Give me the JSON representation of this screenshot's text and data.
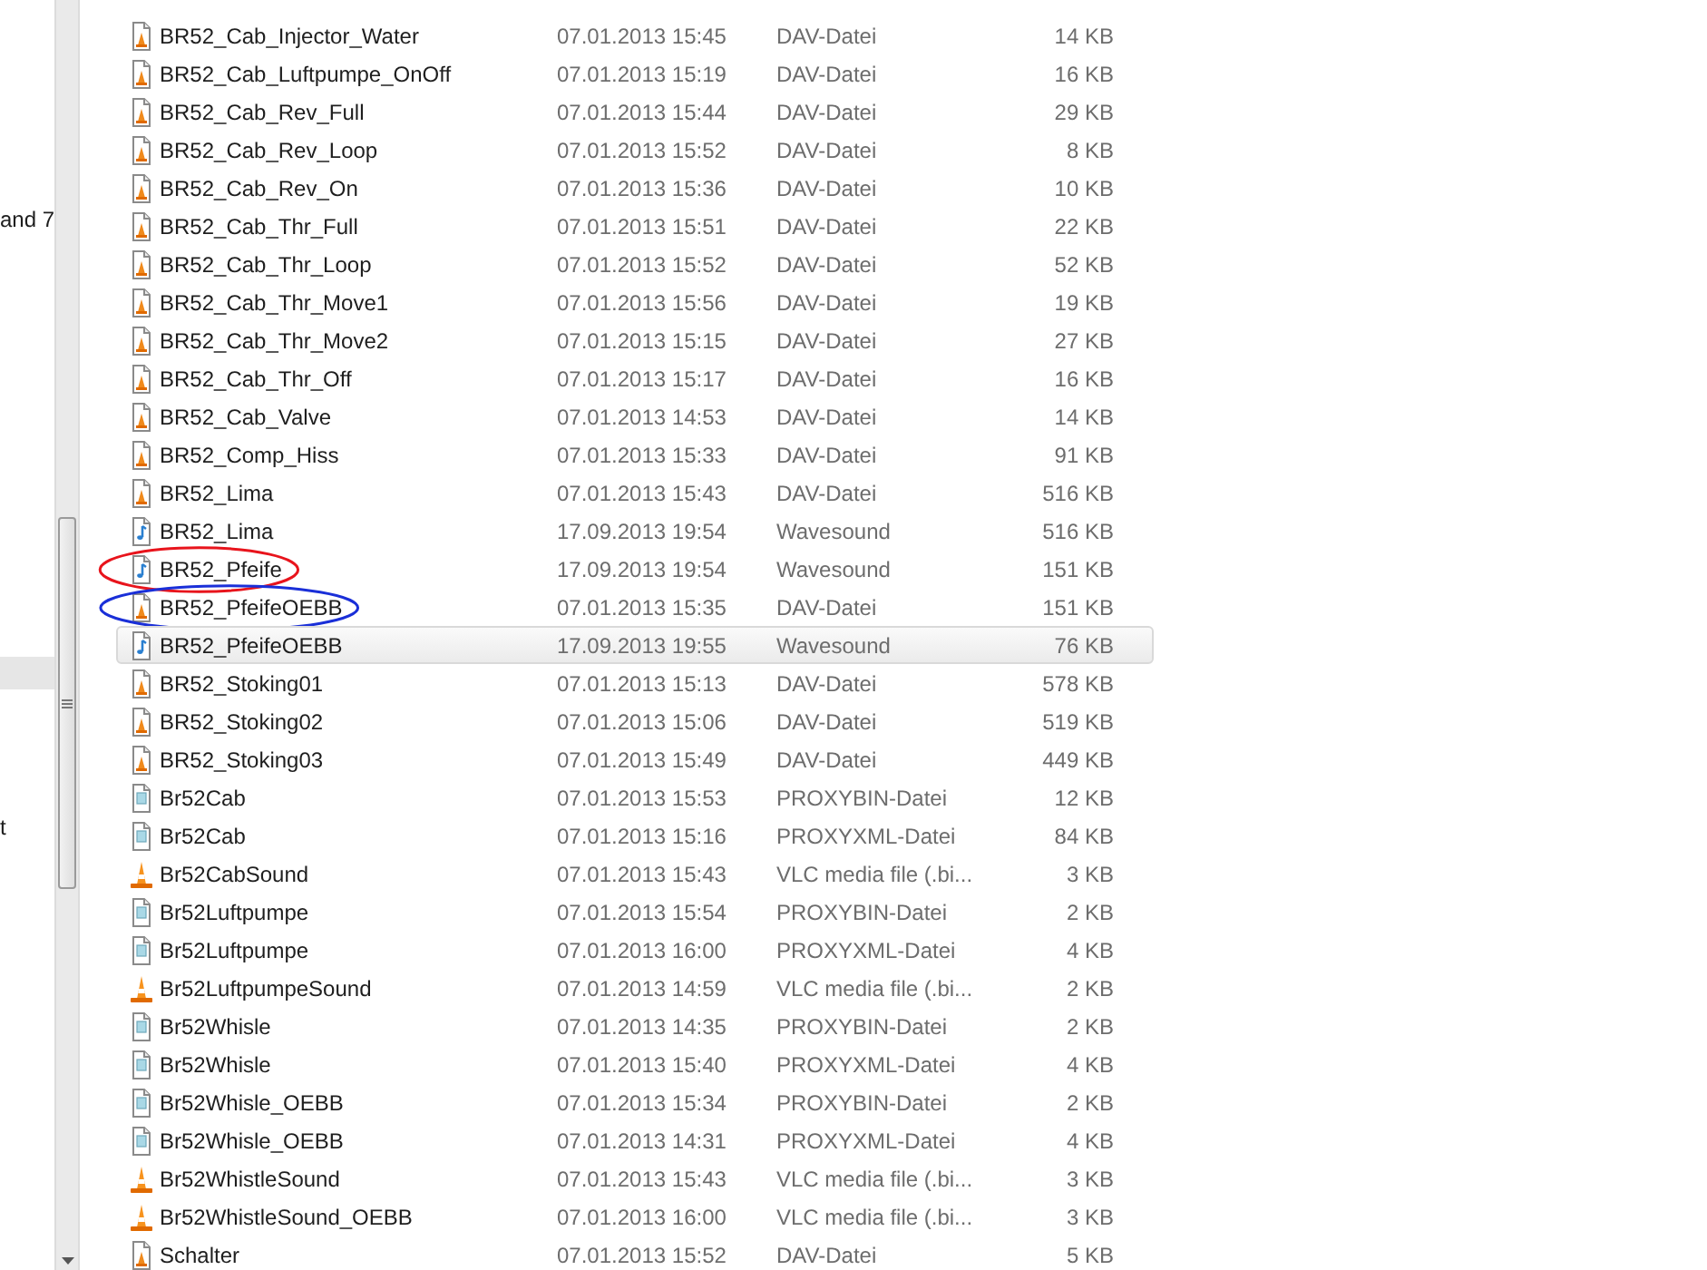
{
  "nav_pane": {
    "items": [
      {
        "label": "and 7",
        "selected": false
      },
      {
        "selected": true
      },
      {
        "label": "t",
        "selected": false
      }
    ]
  },
  "files": [
    {
      "name": "BR52_Cab_Injector_Water",
      "modified": "07.01.2013 15:45",
      "type": "DAV-Datei",
      "size": "14 KB",
      "kind": "dav",
      "selected": false
    },
    {
      "name": "BR52_Cab_Luftpumpe_OnOff",
      "modified": "07.01.2013 15:19",
      "type": "DAV-Datei",
      "size": "16 KB",
      "kind": "dav",
      "selected": false
    },
    {
      "name": "BR52_Cab_Rev_Full",
      "modified": "07.01.2013 15:44",
      "type": "DAV-Datei",
      "size": "29 KB",
      "kind": "dav",
      "selected": false
    },
    {
      "name": "BR52_Cab_Rev_Loop",
      "modified": "07.01.2013 15:52",
      "type": "DAV-Datei",
      "size": "8 KB",
      "kind": "dav",
      "selected": false
    },
    {
      "name": "BR52_Cab_Rev_On",
      "modified": "07.01.2013 15:36",
      "type": "DAV-Datei",
      "size": "10 KB",
      "kind": "dav",
      "selected": false
    },
    {
      "name": "BR52_Cab_Thr_Full",
      "modified": "07.01.2013 15:51",
      "type": "DAV-Datei",
      "size": "22 KB",
      "kind": "dav",
      "selected": false
    },
    {
      "name": "BR52_Cab_Thr_Loop",
      "modified": "07.01.2013 15:52",
      "type": "DAV-Datei",
      "size": "52 KB",
      "kind": "dav",
      "selected": false
    },
    {
      "name": "BR52_Cab_Thr_Move1",
      "modified": "07.01.2013 15:56",
      "type": "DAV-Datei",
      "size": "19 KB",
      "kind": "dav",
      "selected": false
    },
    {
      "name": "BR52_Cab_Thr_Move2",
      "modified": "07.01.2013 15:15",
      "type": "DAV-Datei",
      "size": "27 KB",
      "kind": "dav",
      "selected": false
    },
    {
      "name": "BR52_Cab_Thr_Off",
      "modified": "07.01.2013 15:17",
      "type": "DAV-Datei",
      "size": "16 KB",
      "kind": "dav",
      "selected": false
    },
    {
      "name": "BR52_Cab_Valve",
      "modified": "07.01.2013 14:53",
      "type": "DAV-Datei",
      "size": "14 KB",
      "kind": "dav",
      "selected": false
    },
    {
      "name": "BR52_Comp_Hiss",
      "modified": "07.01.2013 15:33",
      "type": "DAV-Datei",
      "size": "91 KB",
      "kind": "dav",
      "selected": false
    },
    {
      "name": "BR52_Lima",
      "modified": "07.01.2013 15:43",
      "type": "DAV-Datei",
      "size": "516 KB",
      "kind": "dav",
      "selected": false
    },
    {
      "name": "BR52_Lima",
      "modified": "17.09.2013 19:54",
      "type": "Wavesound",
      "size": "516 KB",
      "kind": "wave",
      "selected": false
    },
    {
      "name": "BR52_Pfeife",
      "modified": "17.09.2013 19:54",
      "type": "Wavesound",
      "size": "151 KB",
      "kind": "wave",
      "selected": false,
      "color": "#e8141c"
    },
    {
      "name": "BR52_PfeifeOEBB",
      "modified": "07.01.2013 15:35",
      "type": "DAV-Datei",
      "size": "151 KB",
      "kind": "dav",
      "selected": false,
      "color": "#1a2fd8"
    },
    {
      "name": "BR52_PfeifeOEBB",
      "modified": "17.09.2013 19:55",
      "type": "Wavesound",
      "size": "76 KB",
      "kind": "wave",
      "selected": true
    },
    {
      "name": "BR52_Stoking01",
      "modified": "07.01.2013 15:13",
      "type": "DAV-Datei",
      "size": "578 KB",
      "kind": "dav",
      "selected": false
    },
    {
      "name": "BR52_Stoking02",
      "modified": "07.01.2013 15:06",
      "type": "DAV-Datei",
      "size": "519 KB",
      "kind": "dav",
      "selected": false
    },
    {
      "name": "BR52_Stoking03",
      "modified": "07.01.2013 15:49",
      "type": "DAV-Datei",
      "size": "449 KB",
      "kind": "dav",
      "selected": false
    },
    {
      "name": "Br52Cab",
      "modified": "07.01.2013 15:53",
      "type": "PROXYBIN-Datei",
      "size": "12 KB",
      "kind": "proxy",
      "selected": false
    },
    {
      "name": "Br52Cab",
      "modified": "07.01.2013 15:16",
      "type": "PROXYXML-Datei",
      "size": "84 KB",
      "kind": "proxy",
      "selected": false
    },
    {
      "name": "Br52CabSound",
      "modified": "07.01.2013 15:43",
      "type": "VLC media file (.bi...",
      "size": "3 KB",
      "kind": "vlc",
      "selected": false
    },
    {
      "name": "Br52Luftpumpe",
      "modified": "07.01.2013 15:54",
      "type": "PROXYBIN-Datei",
      "size": "2 KB",
      "kind": "proxy",
      "selected": false
    },
    {
      "name": "Br52Luftpumpe",
      "modified": "07.01.2013 16:00",
      "type": "PROXYXML-Datei",
      "size": "4 KB",
      "kind": "proxy",
      "selected": false
    },
    {
      "name": "Br52LuftpumpeSound",
      "modified": "07.01.2013 14:59",
      "type": "VLC media file (.bi...",
      "size": "2 KB",
      "kind": "vlc",
      "selected": false
    },
    {
      "name": "Br52Whisle",
      "modified": "07.01.2013 14:35",
      "type": "PROXYBIN-Datei",
      "size": "2 KB",
      "kind": "proxy",
      "selected": false
    },
    {
      "name": "Br52Whisle",
      "modified": "07.01.2013 15:40",
      "type": "PROXYXML-Datei",
      "size": "4 KB",
      "kind": "proxy",
      "selected": false
    },
    {
      "name": "Br52Whisle_OEBB",
      "modified": "07.01.2013 15:34",
      "type": "PROXYBIN-Datei",
      "size": "2 KB",
      "kind": "proxy",
      "selected": false
    },
    {
      "name": "Br52Whisle_OEBB",
      "modified": "07.01.2013 14:31",
      "type": "PROXYXML-Datei",
      "size": "4 KB",
      "kind": "proxy",
      "selected": false
    },
    {
      "name": "Br52WhistleSound",
      "modified": "07.01.2013 15:43",
      "type": "VLC media file (.bi...",
      "size": "3 KB",
      "kind": "vlc",
      "selected": false
    },
    {
      "name": "Br52WhistleSound_OEBB",
      "modified": "07.01.2013 16:00",
      "type": "VLC media file (.bi...",
      "size": "3 KB",
      "kind": "vlc",
      "selected": false
    },
    {
      "name": "Schalter",
      "modified": "07.01.2013 15:52",
      "type": "DAV-Datei",
      "size": "5 KB",
      "kind": "dav",
      "selected": false
    }
  ]
}
